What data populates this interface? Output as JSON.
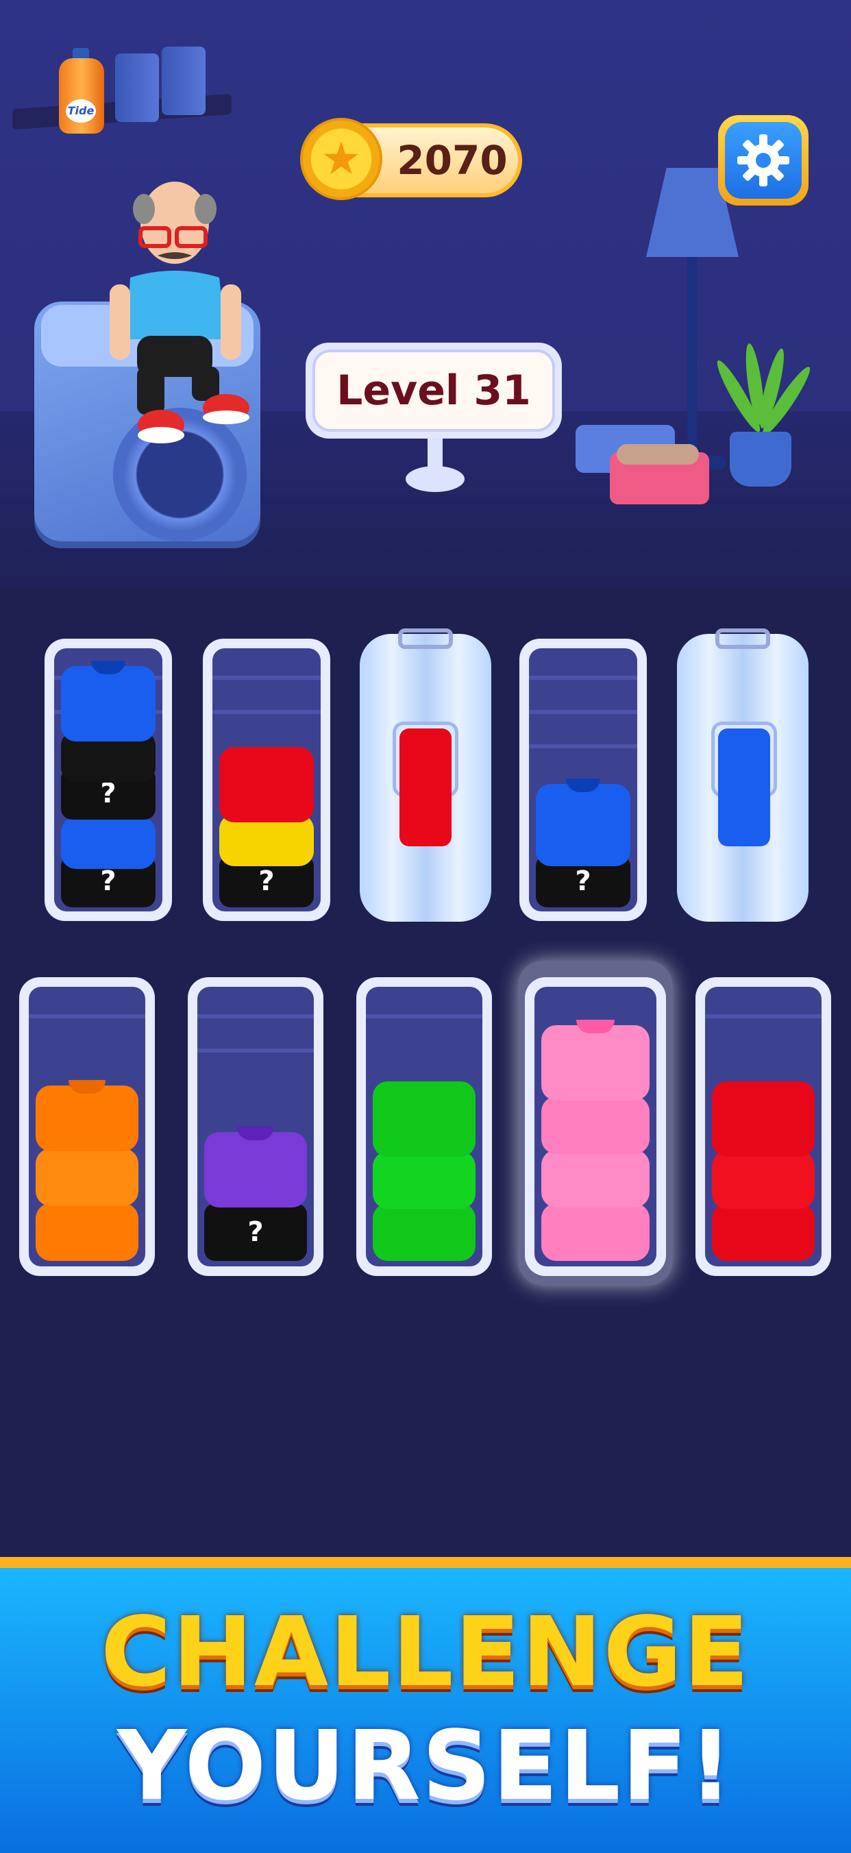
{
  "hud": {
    "coins": "2070",
    "coin_icon": "star-coin-icon",
    "settings_icon": "gear-icon"
  },
  "level": {
    "label": "Level 31"
  },
  "detergent_label": "Tide",
  "colors": {
    "blue": "#1a5ef0",
    "black": "#141414",
    "red": "#e8081a",
    "yellow": "#f7d400",
    "orange": "#ff7a00",
    "purple": "#7a3ad8",
    "green": "#0fc81a",
    "pink": "#ff7fbf",
    "accent_gold": "#ffb31a",
    "banner_blue": "#0a8ff0"
  },
  "racks_top": [
    {
      "id": "rack-1",
      "stack": [
        "blue",
        "black",
        "mystery",
        "blue",
        "mystery"
      ]
    },
    {
      "id": "rack-2",
      "stack": [
        "red",
        "yellow",
        "mystery"
      ]
    },
    {
      "id": "rack-3",
      "covered": true,
      "preview": "red"
    },
    {
      "id": "rack-4",
      "stack": [
        "blue",
        "mystery"
      ]
    },
    {
      "id": "rack-5",
      "covered": true,
      "preview": "blue"
    }
  ],
  "racks_bottom": [
    {
      "id": "rack-6",
      "stack": [
        "orange",
        "orange",
        "orange"
      ]
    },
    {
      "id": "rack-7",
      "stack": [
        "purple",
        "mystery"
      ]
    },
    {
      "id": "rack-8",
      "stack": [
        "green",
        "green",
        "green"
      ]
    },
    {
      "id": "rack-9",
      "stack": [
        "pink",
        "pink",
        "pink",
        "pink"
      ],
      "selected": true
    },
    {
      "id": "rack-10",
      "stack": [
        "red",
        "red",
        "red"
      ]
    }
  ],
  "mystery_mark": "?",
  "banner": {
    "line1": "CHALLENGE",
    "line2": "YOURSELF!"
  }
}
